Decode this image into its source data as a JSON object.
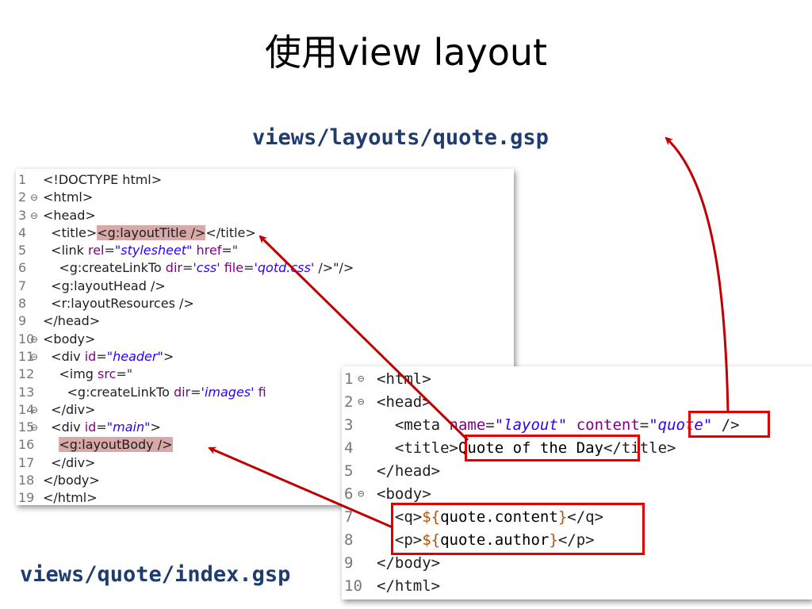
{
  "title": "使用view layout",
  "captions": {
    "layout_path": "views/layouts/quote.gsp",
    "index_path": "views/quote/index.gsp"
  },
  "layout_file": {
    "lines": [
      {
        "n": "1",
        "fold": "",
        "segs": [
          [
            "<!DOCTYPE html>",
            "t-tag"
          ]
        ]
      },
      {
        "n": "2",
        "fold": "⊖",
        "segs": [
          [
            "<html>",
            "t-tag"
          ]
        ]
      },
      {
        "n": "3",
        "fold": "⊖",
        "segs": [
          [
            "<head>",
            "t-tag"
          ]
        ]
      },
      {
        "n": "4",
        "fold": "",
        "segs": [
          [
            "  <title>",
            "t-tag"
          ],
          [
            "<g:layoutTitle />",
            "t-tag hl"
          ],
          [
            "</title>",
            "t-tag"
          ]
        ]
      },
      {
        "n": "5",
        "fold": "",
        "segs": [
          [
            "  <link ",
            "t-tag"
          ],
          [
            "rel",
            "t-attr"
          ],
          [
            "=",
            "t-sep"
          ],
          [
            "\"stylesheet\"",
            "t-str"
          ],
          [
            " href",
            "t-attr"
          ],
          [
            "=\"",
            "t-sep"
          ]
        ]
      },
      {
        "n": "6",
        "fold": "",
        "segs": [
          [
            "    <g:createLinkTo ",
            "t-tag"
          ],
          [
            "dir",
            "t-attr"
          ],
          [
            "=",
            "t-sep"
          ],
          [
            "'css'",
            "t-str"
          ],
          [
            " file",
            "t-attr"
          ],
          [
            "=",
            "t-sep"
          ],
          [
            "'qotd.css'",
            "t-str"
          ],
          [
            " />\"/>",
            "t-tag"
          ]
        ]
      },
      {
        "n": "7",
        "fold": "",
        "segs": [
          [
            "  <g:layoutHead />",
            "t-tag"
          ]
        ]
      },
      {
        "n": "8",
        "fold": "",
        "segs": [
          [
            "  <r:layoutResources />",
            "t-tag"
          ]
        ]
      },
      {
        "n": "9",
        "fold": "",
        "segs": [
          [
            "</head>",
            "t-tag"
          ]
        ]
      },
      {
        "n": "10",
        "fold": "⊖",
        "segs": [
          [
            "<body>",
            "t-tag"
          ]
        ]
      },
      {
        "n": "11",
        "fold": "⊖",
        "segs": [
          [
            "  <div ",
            "t-tag"
          ],
          [
            "id",
            "t-attr"
          ],
          [
            "=",
            "t-sep"
          ],
          [
            "\"header\"",
            "t-str"
          ],
          [
            ">",
            "t-tag"
          ]
        ]
      },
      {
        "n": "12",
        "fold": "",
        "segs": [
          [
            "    <img ",
            "t-tag"
          ],
          [
            "src",
            "t-attr"
          ],
          [
            "=\"",
            "t-sep"
          ]
        ]
      },
      {
        "n": "13",
        "fold": "",
        "segs": [
          [
            "      <g:createLinkTo ",
            "t-tag"
          ],
          [
            "dir",
            "t-attr"
          ],
          [
            "=",
            "t-sep"
          ],
          [
            "'images'",
            "t-str"
          ],
          [
            " fi",
            "t-attr"
          ]
        ]
      },
      {
        "n": "14",
        "fold": "⊖",
        "segs": [
          [
            "  </div>",
            "t-tag"
          ]
        ]
      },
      {
        "n": "15",
        "fold": "⊖",
        "segs": [
          [
            "  <div ",
            "t-tag"
          ],
          [
            "id",
            "t-attr"
          ],
          [
            "=",
            "t-sep"
          ],
          [
            "\"main\"",
            "t-str"
          ],
          [
            ">",
            "t-tag"
          ]
        ]
      },
      {
        "n": "16",
        "fold": "",
        "segs": [
          [
            "    ",
            "t-tag"
          ],
          [
            "<g:layoutBody />",
            "t-tag hl"
          ]
        ]
      },
      {
        "n": "17",
        "fold": "",
        "segs": [
          [
            "  </div>",
            "t-tag"
          ]
        ]
      },
      {
        "n": "18",
        "fold": "",
        "segs": [
          [
            "</body>",
            "t-tag"
          ]
        ]
      },
      {
        "n": "19",
        "fold": "",
        "segs": [
          [
            "</html>",
            "t-tag"
          ]
        ]
      }
    ]
  },
  "index_file": {
    "lines": [
      {
        "n": "1",
        "fold": "⊖",
        "segs": [
          [
            "<html>",
            "t-tag"
          ]
        ]
      },
      {
        "n": "2",
        "fold": "⊖",
        "segs": [
          [
            "<head>",
            "t-tag"
          ]
        ]
      },
      {
        "n": "3",
        "fold": "",
        "segs": [
          [
            "  <meta ",
            "t-tag"
          ],
          [
            "name",
            "t-attr"
          ],
          [
            "=",
            "t-sep"
          ],
          [
            "\"layout\"",
            "t-str"
          ],
          [
            " content",
            "t-attr"
          ],
          [
            "=",
            "t-sep"
          ],
          [
            "\"quote\"",
            "t-str"
          ],
          [
            " />",
            "t-tag"
          ]
        ]
      },
      {
        "n": "4",
        "fold": "",
        "segs": [
          [
            "  <title>",
            "t-tag"
          ],
          [
            "Quote of the Day",
            "t-text"
          ],
          [
            "</title>",
            "t-tag"
          ]
        ]
      },
      {
        "n": "5",
        "fold": "",
        "segs": [
          [
            "</head>",
            "t-tag"
          ]
        ]
      },
      {
        "n": "6",
        "fold": "⊖",
        "segs": [
          [
            "<body>",
            "t-tag"
          ]
        ]
      },
      {
        "n": "7",
        "fold": "",
        "segs": [
          [
            "  <q>",
            "t-tag"
          ],
          [
            "${",
            "t-dollar"
          ],
          [
            "quote.content",
            "t-text"
          ],
          [
            "}",
            "t-dollar"
          ],
          [
            "</q>",
            "t-tag"
          ]
        ]
      },
      {
        "n": "8",
        "fold": "",
        "segs": [
          [
            "  <p>",
            "t-tag"
          ],
          [
            "${",
            "t-dollar"
          ],
          [
            "quote.author",
            "t-text"
          ],
          [
            "}",
            "t-dollar"
          ],
          [
            "</p>",
            "t-tag"
          ]
        ]
      },
      {
        "n": "9",
        "fold": "",
        "segs": [
          [
            "</body>",
            "t-tag"
          ]
        ]
      },
      {
        "n": "10",
        "fold": "",
        "segs": [
          [
            "</html>",
            "t-tag"
          ]
        ]
      }
    ]
  },
  "colors": {
    "arrow": "#c00000",
    "highlight_box": "#e00000",
    "caption": "#1f3c6e"
  }
}
